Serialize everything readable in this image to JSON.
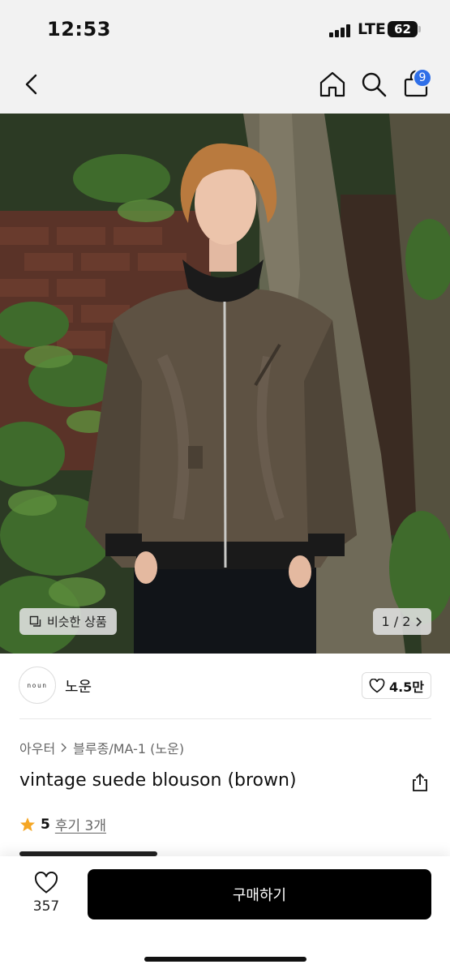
{
  "status": {
    "time": "12:53",
    "network": "LTE",
    "battery": "62"
  },
  "nav": {
    "icons": [
      "chevron-left-icon",
      "home-icon",
      "search-icon",
      "shopping-bag-icon"
    ],
    "cart_count": "9"
  },
  "gallery": {
    "similar_label": "비슷한 상품",
    "page_indicator": "1 / 2"
  },
  "shop": {
    "logo_text": "noun",
    "name": "노운",
    "likes": "4.5만"
  },
  "product": {
    "breadcrumb": [
      "아우터",
      "블루종/MA-1 (노운)"
    ],
    "title": "vintage suede blouson (brown)",
    "rating": "5",
    "reviews": "후기 3개"
  },
  "bottom": {
    "wish_count": "357",
    "buy_label": "구매하기"
  },
  "colors": {
    "accent_badge": "#2f6fe8",
    "star": "#f5a623",
    "buy_button": "#000000"
  }
}
